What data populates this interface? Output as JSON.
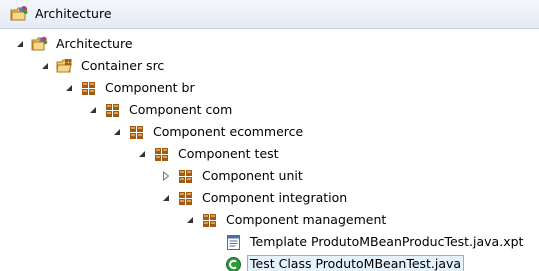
{
  "view": {
    "title": "Architecture",
    "title_icon": "project-icon"
  },
  "tree": {
    "nodes": [
      {
        "label": "Architecture",
        "icon": "project-icon",
        "expanded": true
      },
      {
        "label": "Container src",
        "icon": "source-folder-icon",
        "expanded": true
      },
      {
        "label": "Component br",
        "icon": "package-icon",
        "expanded": true
      },
      {
        "label": "Component com",
        "icon": "package-icon",
        "expanded": true
      },
      {
        "label": "Component ecommerce",
        "icon": "package-icon",
        "expanded": true
      },
      {
        "label": "Component test",
        "icon": "package-icon",
        "expanded": true
      },
      {
        "label": "Component unit",
        "icon": "package-icon",
        "expanded": false
      },
      {
        "label": "Component integration",
        "icon": "package-icon",
        "expanded": true
      },
      {
        "label": "Component management",
        "icon": "package-icon",
        "expanded": true
      },
      {
        "label": "Template ProdutoMBeanProducTest.java.xpt",
        "icon": "template-file-icon",
        "expanded": null
      },
      {
        "label": "Test Class ProdutoMBeanTest.java",
        "icon": "java-class-icon",
        "expanded": null,
        "selected": true
      }
    ]
  },
  "colors": {
    "package": "#a05a12",
    "class_green": "#2e9a3c",
    "selection_fill": "#e5f1fb",
    "selection_border": "#7eb4ea"
  }
}
